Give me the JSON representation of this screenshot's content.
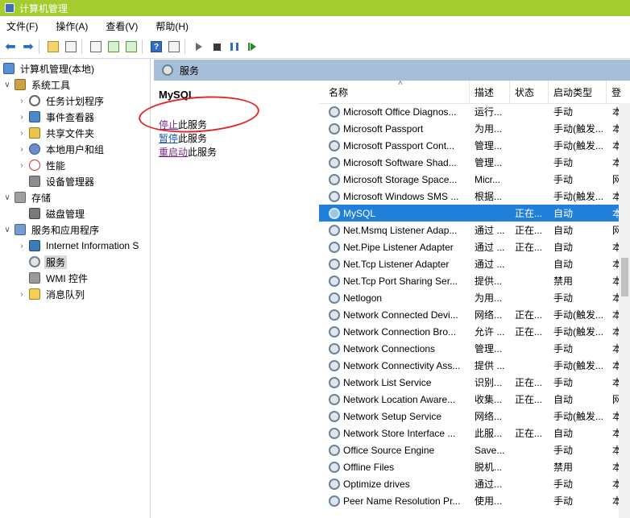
{
  "window": {
    "title": "计算机管理"
  },
  "menu": [
    "文件(F)",
    "操作(A)",
    "查看(V)",
    "帮助(H)"
  ],
  "tree": {
    "root": "计算机管理(本地)",
    "system_tools": "系统工具",
    "task_scheduler": "任务计划程序",
    "event_viewer": "事件查看器",
    "shared_folders": "共享文件夹",
    "local_users": "本地用户和组",
    "performance": "性能",
    "device_manager": "设备管理器",
    "storage": "存储",
    "disk_management": "磁盘管理",
    "services_apps": "服务和应用程序",
    "iis": "Internet Information S",
    "services": "服务",
    "wmi": "WMI 控件",
    "message_queue": "消息队列"
  },
  "panel": {
    "header": "服务",
    "selected_service": "MySQL",
    "actions": {
      "stop_link": "停止",
      "stop_rest": "此服务",
      "pause_link": "暂停",
      "pause_rest": "此服务",
      "restart_link": "重启动",
      "restart_rest": "此服务"
    }
  },
  "columns": {
    "name": "名称",
    "desc": "描述",
    "status": "状态",
    "startup": "启动类型",
    "logon": "登"
  },
  "services": [
    {
      "name": "Microsoft Office Diagnos...",
      "desc": "运行...",
      "status": "",
      "startup": "手动",
      "logon": "本"
    },
    {
      "name": "Microsoft Passport",
      "desc": "为用...",
      "status": "",
      "startup": "手动(触发...",
      "logon": "本"
    },
    {
      "name": "Microsoft Passport Cont...",
      "desc": "管理...",
      "status": "",
      "startup": "手动(触发...",
      "logon": "本"
    },
    {
      "name": "Microsoft Software Shad...",
      "desc": "管理...",
      "status": "",
      "startup": "手动",
      "logon": "本"
    },
    {
      "name": "Microsoft Storage Space...",
      "desc": "Micr...",
      "status": "",
      "startup": "手动",
      "logon": "网"
    },
    {
      "name": "Microsoft Windows SMS ...",
      "desc": "根据...",
      "status": "",
      "startup": "手动(触发...",
      "logon": "本"
    },
    {
      "name": "MySQL",
      "desc": "",
      "status": "正在...",
      "startup": "自动",
      "logon": "本",
      "selected": true
    },
    {
      "name": "Net.Msmq Listener Adap...",
      "desc": "通过 ...",
      "status": "正在...",
      "startup": "自动",
      "logon": "网"
    },
    {
      "name": "Net.Pipe Listener Adapter",
      "desc": "通过 ...",
      "status": "正在...",
      "startup": "自动",
      "logon": "本"
    },
    {
      "name": "Net.Tcp Listener Adapter",
      "desc": "通过 ...",
      "status": "",
      "startup": "自动",
      "logon": "本"
    },
    {
      "name": "Net.Tcp Port Sharing Ser...",
      "desc": "提供...",
      "status": "",
      "startup": "禁用",
      "logon": "本"
    },
    {
      "name": "Netlogon",
      "desc": "为用...",
      "status": "",
      "startup": "手动",
      "logon": "本"
    },
    {
      "name": "Network Connected Devi...",
      "desc": "网络...",
      "status": "正在...",
      "startup": "手动(触发...",
      "logon": "本"
    },
    {
      "name": "Network Connection Bro...",
      "desc": "允许 ...",
      "status": "正在...",
      "startup": "手动(触发...",
      "logon": "本"
    },
    {
      "name": "Network Connections",
      "desc": "管理...",
      "status": "",
      "startup": "手动",
      "logon": "本"
    },
    {
      "name": "Network Connectivity Ass...",
      "desc": "提供 ...",
      "status": "",
      "startup": "手动(触发...",
      "logon": "本"
    },
    {
      "name": "Network List Service",
      "desc": "识别...",
      "status": "正在...",
      "startup": "手动",
      "logon": "本"
    },
    {
      "name": "Network Location Aware...",
      "desc": "收集...",
      "status": "正在...",
      "startup": "自动",
      "logon": "网"
    },
    {
      "name": "Network Setup Service",
      "desc": "网络...",
      "status": "",
      "startup": "手动(触发...",
      "logon": "本"
    },
    {
      "name": "Network Store Interface ...",
      "desc": "此服...",
      "status": "正在...",
      "startup": "自动",
      "logon": "本"
    },
    {
      "name": "Office  Source Engine",
      "desc": "Save...",
      "status": "",
      "startup": "手动",
      "logon": "本"
    },
    {
      "name": "Offline Files",
      "desc": "脱机...",
      "status": "",
      "startup": "禁用",
      "logon": "本"
    },
    {
      "name": "Optimize drives",
      "desc": "通过...",
      "status": "",
      "startup": "手动",
      "logon": "本"
    },
    {
      "name": "Peer Name Resolution Pr...",
      "desc": "使用...",
      "status": "",
      "startup": "手动",
      "logon": "本"
    }
  ]
}
